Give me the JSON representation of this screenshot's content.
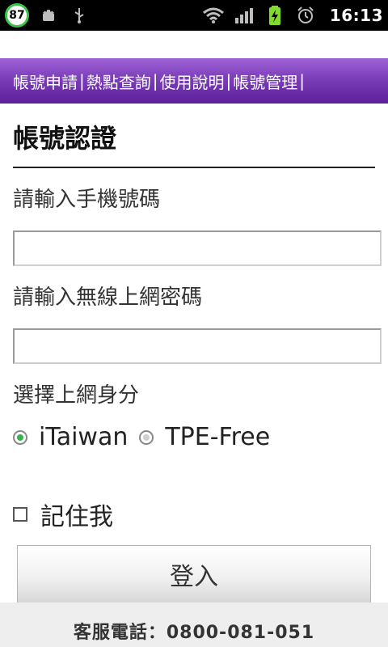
{
  "status_bar": {
    "battery_percent": "87",
    "time": "16:13",
    "icons": [
      "android-debug-icon",
      "usb-icon",
      "wifi-icon",
      "signal-icon",
      "battery-charging-icon",
      "alarm-icon"
    ],
    "accent": "#39c54a"
  },
  "nav": {
    "items": [
      {
        "label": "帳號申請"
      },
      {
        "label": "熱點查詢"
      },
      {
        "label": "使用說明"
      },
      {
        "label": "帳號管理"
      }
    ],
    "separator": "|",
    "color": "#7b3eb9"
  },
  "page": {
    "title": "帳號認證"
  },
  "form": {
    "phone_label": "請輸入手機號碼",
    "phone_value": "",
    "password_label": "請輸入無線上網密碼",
    "password_value": "",
    "identity_label": "選擇上網身分",
    "options": [
      {
        "label": "iTaiwan",
        "selected": true
      },
      {
        "label": "TPE-Free",
        "selected": false
      }
    ],
    "remember_label": "記住我",
    "remember_checked": false,
    "login_label": "登入"
  },
  "footer": {
    "text": "客服電話：0800-081-051"
  }
}
